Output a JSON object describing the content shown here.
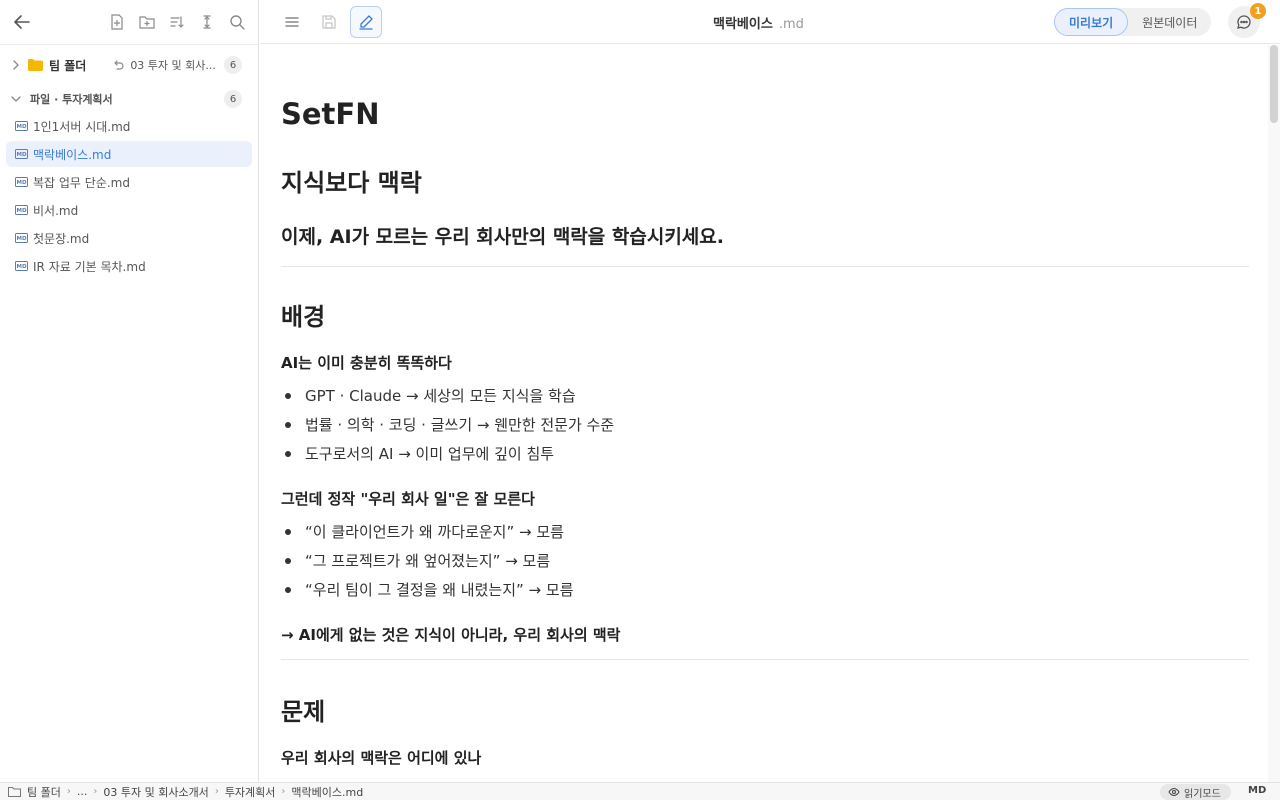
{
  "sidebar": {
    "team_folder": {
      "label": "팀 폴더",
      "recent_path": "03 투자 및 회사...",
      "count": "6"
    },
    "group": {
      "label": "파일 · 투자계획서",
      "count": "6"
    },
    "files": [
      "1인1서버 시대.md",
      "맥락베이스.md",
      "복잡 업무 단순.md",
      "비서.md",
      "첫문장.md",
      "IR 자료 기본 목차.md"
    ]
  },
  "topbar": {
    "doc_name": "맥락베이스",
    "doc_ext": ".md",
    "preview_label": "미리보기",
    "source_label": "원본데이터",
    "notification_count": "1"
  },
  "document": {
    "title": "SetFN",
    "heading1": "지식보다 맥락",
    "subheading": "이제, AI가 모르는 우리 회사만의 맥락을 학습시키세요.",
    "section_background": "배경",
    "bold1": "AI는 이미 충분히 똑똑하다",
    "list1": [
      "GPT · Claude → 세상의 모든 지식을 학습",
      "법률 · 의학 · 코딩 · 글쓰기 → 웬만한 전문가 수준",
      "도구로서의 AI → 이미 업무에 깊이 침투"
    ],
    "bold2": "그런데 정작 \"우리 회사 일\"은 잘 모른다",
    "list2": [
      "“이 클라이언트가 왜 까다로운지” → 모름",
      "“그 프로젝트가 왜 엎어졌는지” → 모름",
      "“우리 팀이 그 결정을 왜 내렸는지” → 모름"
    ],
    "bold3": "→ AI에게 없는 것은 지식이 아니라, 우리 회사의 맥락",
    "section_problem": "문제",
    "bold4": "우리 회사의 맥락은 어디에 있나"
  },
  "statusbar": {
    "breadcrumbs": [
      "팀 폴더",
      "...",
      "03 투자 및 회사소개서",
      "투자계획서",
      "맥락베이스.md"
    ],
    "read_mode_label": "읽기모드",
    "format_label": "MD"
  },
  "colors": {
    "accent": "#3a7bd5",
    "active_bg": "#eaf1fd",
    "badge": "#f0a020",
    "folder": "#f5b800"
  }
}
